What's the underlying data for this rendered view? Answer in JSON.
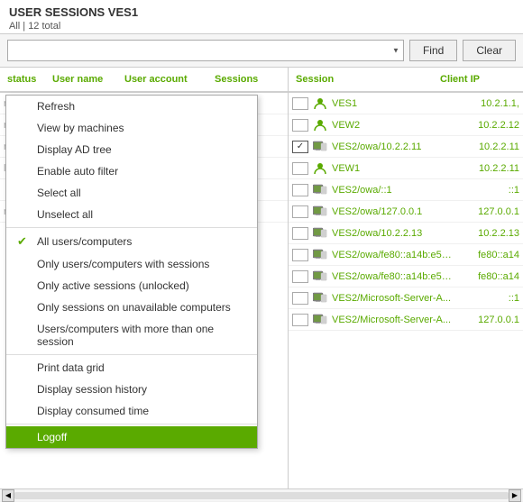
{
  "header": {
    "title": "USER SESSIONS  VES1",
    "count": "All | 12 total"
  },
  "toolbar": {
    "search_placeholder": "",
    "find_label": "Find",
    "clear_label": "Clear"
  },
  "columns_left": {
    "status": "status",
    "username": "User name",
    "useraccount": "User account",
    "sessions": "Sessions"
  },
  "columns_right": {
    "session": "Session",
    "clientip": "Client IP"
  },
  "context_menu": {
    "items": [
      {
        "id": "refresh",
        "label": "Refresh",
        "check": false,
        "divider_after": false
      },
      {
        "id": "view-by-machines",
        "label": "View by machines",
        "check": false,
        "divider_after": false
      },
      {
        "id": "display-ad-tree",
        "label": "Display AD tree",
        "check": false,
        "divider_after": false
      },
      {
        "id": "enable-auto-filter",
        "label": "Enable auto filter",
        "check": false,
        "divider_after": false
      },
      {
        "id": "select-all",
        "label": "Select all",
        "check": false,
        "divider_after": false
      },
      {
        "id": "unselect-all",
        "label": "Unselect all",
        "check": false,
        "divider_after": true
      },
      {
        "id": "all-users",
        "label": "All users/computers",
        "check": true,
        "checked": true,
        "divider_after": false
      },
      {
        "id": "only-with-sessions",
        "label": "Only users/computers with sessions",
        "check": true,
        "checked": false,
        "divider_after": false
      },
      {
        "id": "only-active",
        "label": "Only active sessions (unlocked)",
        "check": true,
        "checked": false,
        "divider_after": false
      },
      {
        "id": "only-unavailable",
        "label": "Only sessions on unavailable computers",
        "check": true,
        "checked": false,
        "divider_after": false
      },
      {
        "id": "more-than-one",
        "label": "Users/computers with more than one session",
        "check": true,
        "checked": false,
        "divider_after": true
      },
      {
        "id": "print-data-grid",
        "label": "Print data grid",
        "check": false,
        "divider_after": false
      },
      {
        "id": "display-session-history",
        "label": "Display session history",
        "check": false,
        "divider_after": false
      },
      {
        "id": "display-consumed-time",
        "label": "Display consumed time",
        "check": false,
        "divider_after": true
      },
      {
        "id": "logoff",
        "label": "Logoff",
        "check": false,
        "highlighted": true,
        "divider_after": false
      }
    ]
  },
  "sessions": [
    {
      "id": "s1",
      "checked": false,
      "icon": "user",
      "name": "VES1",
      "ip": "10.2.1.1,"
    },
    {
      "id": "s2",
      "checked": false,
      "icon": "user",
      "name": "VEW2",
      "ip": "10.2.2.12"
    },
    {
      "id": "s3",
      "checked": true,
      "icon": "session",
      "name": "VES2/owa/10.2.2.11",
      "ip": "10.2.2.11"
    },
    {
      "id": "s4",
      "checked": false,
      "icon": "user",
      "name": "VEW1",
      "ip": "10.2.2.11"
    },
    {
      "id": "s5",
      "checked": false,
      "icon": "session",
      "name": "VES2/owa/::1",
      "ip": "::1"
    },
    {
      "id": "s6",
      "checked": false,
      "icon": "session",
      "name": "VES2/owa/127.0.0.1",
      "ip": "127.0.0.1"
    },
    {
      "id": "s7",
      "checked": false,
      "icon": "session",
      "name": "VES2/owa/10.2.2.13",
      "ip": "10.2.2.13"
    },
    {
      "id": "s8",
      "checked": false,
      "icon": "session",
      "name": "VES2/owa/fe80::a14b:e5e:...",
      "ip": "fe80::a14"
    },
    {
      "id": "s9",
      "checked": false,
      "icon": "session",
      "name": "VES2/owa/fe80::a14b:e5e:...",
      "ip": "fe80::a14"
    },
    {
      "id": "s10",
      "checked": false,
      "icon": "session",
      "name": "VES2/Microsoft-Server-A...",
      "ip": "::1"
    },
    {
      "id": "s11",
      "checked": false,
      "icon": "session",
      "name": "VES2/Microsoft-Server-A...",
      "ip": "127.0.0.1"
    }
  ]
}
